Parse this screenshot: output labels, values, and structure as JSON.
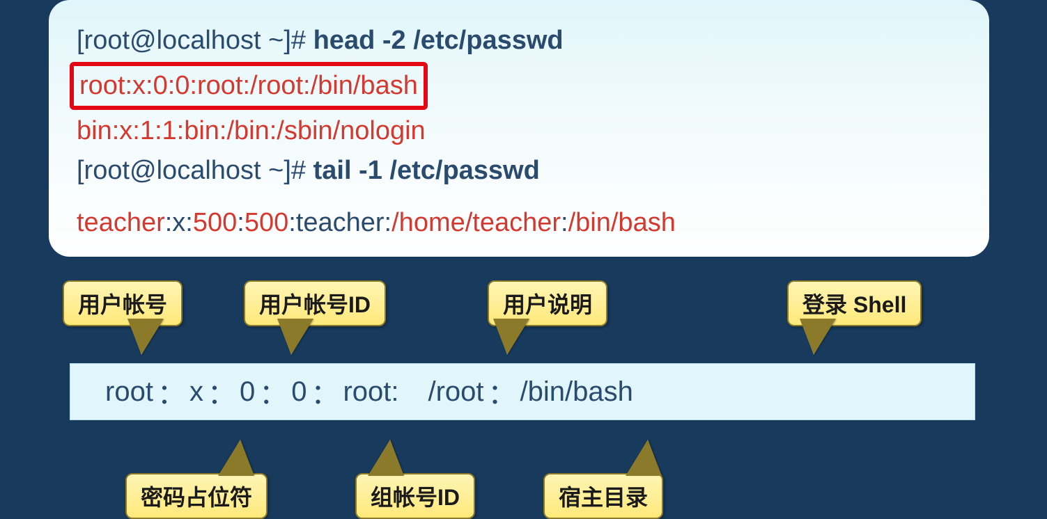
{
  "terminal": {
    "prompt": "[root@localhost ~]#",
    "cmd1": "head -2 /etc/passwd",
    "line1": "root:x:0:0:root:/root:/bin/bash",
    "line2": "bin:x:1:1:bin:/bin:/sbin/nologin",
    "cmd2": "tail -1 /etc/passwd",
    "line3_parts": {
      "p1": "teacher",
      "p2": ":x:",
      "p3": "500",
      "p4": ":",
      "p5": "500",
      "p6": ":teacher:",
      "p7": "/home/teacher",
      "p8": ":",
      "p9": "/bin/bash"
    }
  },
  "breakdown": {
    "f1": "root",
    "sep": "：",
    "f2": "x",
    "f3": "0",
    "f4": "0",
    "f5": "root:",
    "f6": "/root",
    "f7": "/bin/bash"
  },
  "labels": {
    "user_account": "用户帐号",
    "user_id": "用户帐号ID",
    "user_desc": "用户说明",
    "login_shell": "登录 Shell",
    "pw_placeholder": "密码占位符",
    "group_id": "组帐号ID",
    "home_dir": "宿主目录"
  }
}
